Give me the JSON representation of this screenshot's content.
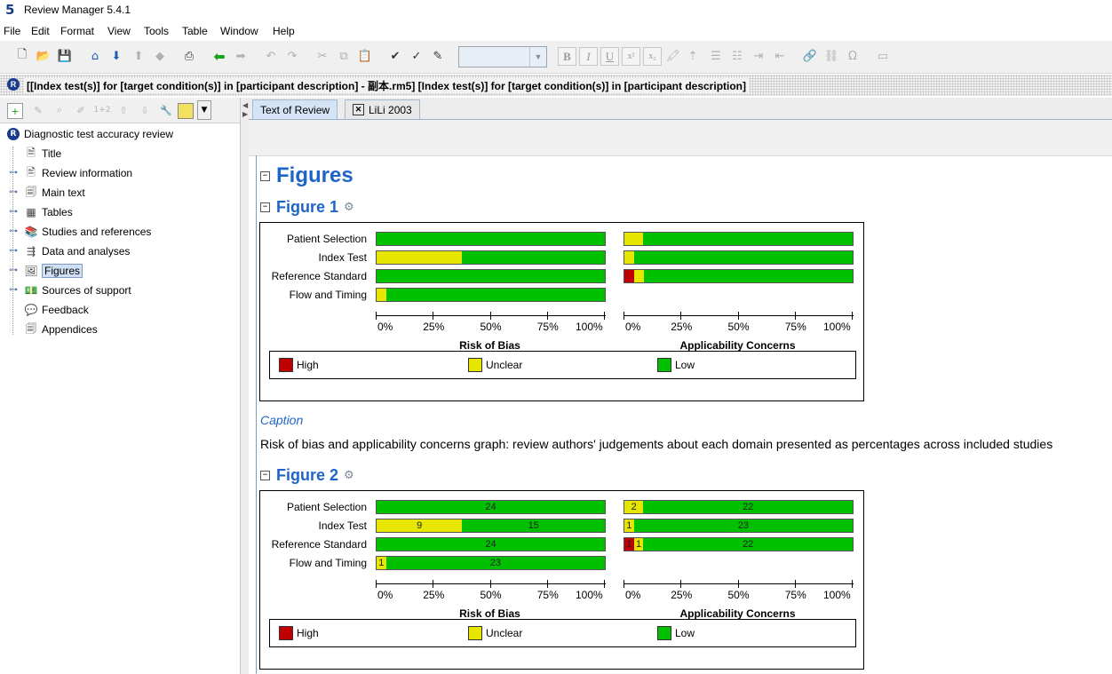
{
  "window": {
    "app_icon": "5",
    "title": "Review Manager 5.4.1"
  },
  "menu": [
    "File",
    "Edit",
    "Format",
    "View",
    "Tools",
    "Table",
    "Window",
    "Help"
  ],
  "toolbar": {
    "icons": [
      "new-file-icon",
      "open-folder-icon",
      "save-icon",
      "home-icon",
      "download-icon",
      "print-icon",
      "back-arrow-icon",
      "forward-arrow-icon",
      "undo-icon",
      "redo-icon",
      "cut-icon",
      "copy-icon",
      "paste-icon",
      "spellcheck-icon",
      "spell-abc-icon",
      "edit-note-icon"
    ],
    "font_combo_value": "",
    "format_buttons": [
      "B",
      "I",
      "U",
      "x²",
      "x₂"
    ]
  },
  "document_bar": {
    "title": "[[Index test(s)] for [target condition(s)] in [participant description] - 副本.rm5] [Index test(s)] for [target condition(s)] in [participant description]"
  },
  "left_toolbar": {
    "buttons": [
      "add-icon",
      "edit-icon",
      "find-icon",
      "edit-doc-icon",
      "1+2",
      "move-up-icon",
      "move-down-icon",
      "wrench-icon",
      "note-icon",
      "dropdown-icon"
    ]
  },
  "tree": {
    "root": "Diagnostic test accuracy review",
    "items": [
      {
        "label": "Title",
        "icon": "page-icon",
        "expandable": false
      },
      {
        "label": "Review information",
        "icon": "doc-icon",
        "expandable": true
      },
      {
        "label": "Main text",
        "icon": "docs-icon",
        "expandable": true
      },
      {
        "label": "Tables",
        "icon": "table-icon",
        "expandable": true
      },
      {
        "label": "Studies and references",
        "icon": "books-icon",
        "expandable": true
      },
      {
        "label": "Data and analyses",
        "icon": "data-icon",
        "expandable": true
      },
      {
        "label": "Figures",
        "icon": "image-icon",
        "expandable": true,
        "selected": true
      },
      {
        "label": "Sources of support",
        "icon": "money-icon",
        "expandable": true
      },
      {
        "label": "Feedback",
        "icon": "feedback-icon",
        "expandable": false
      },
      {
        "label": "Appendices",
        "icon": "docs-icon",
        "expandable": false
      }
    ]
  },
  "tabs": [
    {
      "label": "Text of Review",
      "active": true
    },
    {
      "label": "LiLi 2003",
      "active": false,
      "closable": true
    }
  ],
  "content": {
    "section_title": "Figures",
    "figure1_title": "Figure 1",
    "figure2_title": "Figure 2",
    "caption_heading": "Caption",
    "caption_text": "Risk of bias and applicability concerns graph: review authors' judgements about each domain presented as percentages across included studies"
  },
  "colors": {
    "high": "#c00000",
    "unclear": "#e6e600",
    "low": "#00c000",
    "heading": "#1f65c8"
  },
  "chart_data": [
    {
      "type": "bar",
      "orientation": "horizontal-stacked-percent",
      "categories": [
        "Patient Selection",
        "Index Test",
        "Reference Standard",
        "Flow and Timing"
      ],
      "panels": [
        {
          "title": "Risk of Bias",
          "series": [
            {
              "name": "High",
              "values": [
                0,
                0,
                0,
                0
              ]
            },
            {
              "name": "Unclear",
              "values": [
                0,
                37.5,
                0,
                4.2
              ]
            },
            {
              "name": "Low",
              "values": [
                100,
                62.5,
                100,
                95.8
              ]
            }
          ]
        },
        {
          "title": "Applicability Concerns",
          "series": [
            {
              "name": "High",
              "values": [
                0,
                0,
                4.2
              ]
            },
            {
              "name": "Unclear",
              "values": [
                8.3,
                4.2,
                4.2
              ]
            },
            {
              "name": "Low",
              "values": [
                91.7,
                95.8,
                91.7
              ]
            }
          ]
        }
      ],
      "xticks": [
        "0%",
        "25%",
        "50%",
        "75%",
        "100%"
      ],
      "xlim": [
        0,
        100
      ],
      "legend": [
        "High",
        "Unclear",
        "Low"
      ],
      "data_labels": false
    },
    {
      "type": "bar",
      "orientation": "horizontal-stacked-percent",
      "categories": [
        "Patient Selection",
        "Index Test",
        "Reference Standard",
        "Flow and Timing"
      ],
      "panels": [
        {
          "title": "Risk of Bias",
          "series": [
            {
              "name": "High",
              "values": [
                0,
                0,
                0,
                0
              ]
            },
            {
              "name": "Unclear",
              "values": [
                0,
                9,
                0,
                1
              ]
            },
            {
              "name": "Low",
              "values": [
                24,
                15,
                24,
                23
              ]
            }
          ]
        },
        {
          "title": "Applicability Concerns",
          "series": [
            {
              "name": "High",
              "values": [
                0,
                0,
                1
              ]
            },
            {
              "name": "Unclear",
              "values": [
                2,
                1,
                1
              ]
            },
            {
              "name": "Low",
              "values": [
                22,
                23,
                22
              ]
            }
          ]
        }
      ],
      "xticks": [
        "0%",
        "25%",
        "50%",
        "75%",
        "100%"
      ],
      "xlim": [
        0,
        100
      ],
      "legend": [
        "High",
        "Unclear",
        "Low"
      ],
      "data_labels": true
    }
  ]
}
